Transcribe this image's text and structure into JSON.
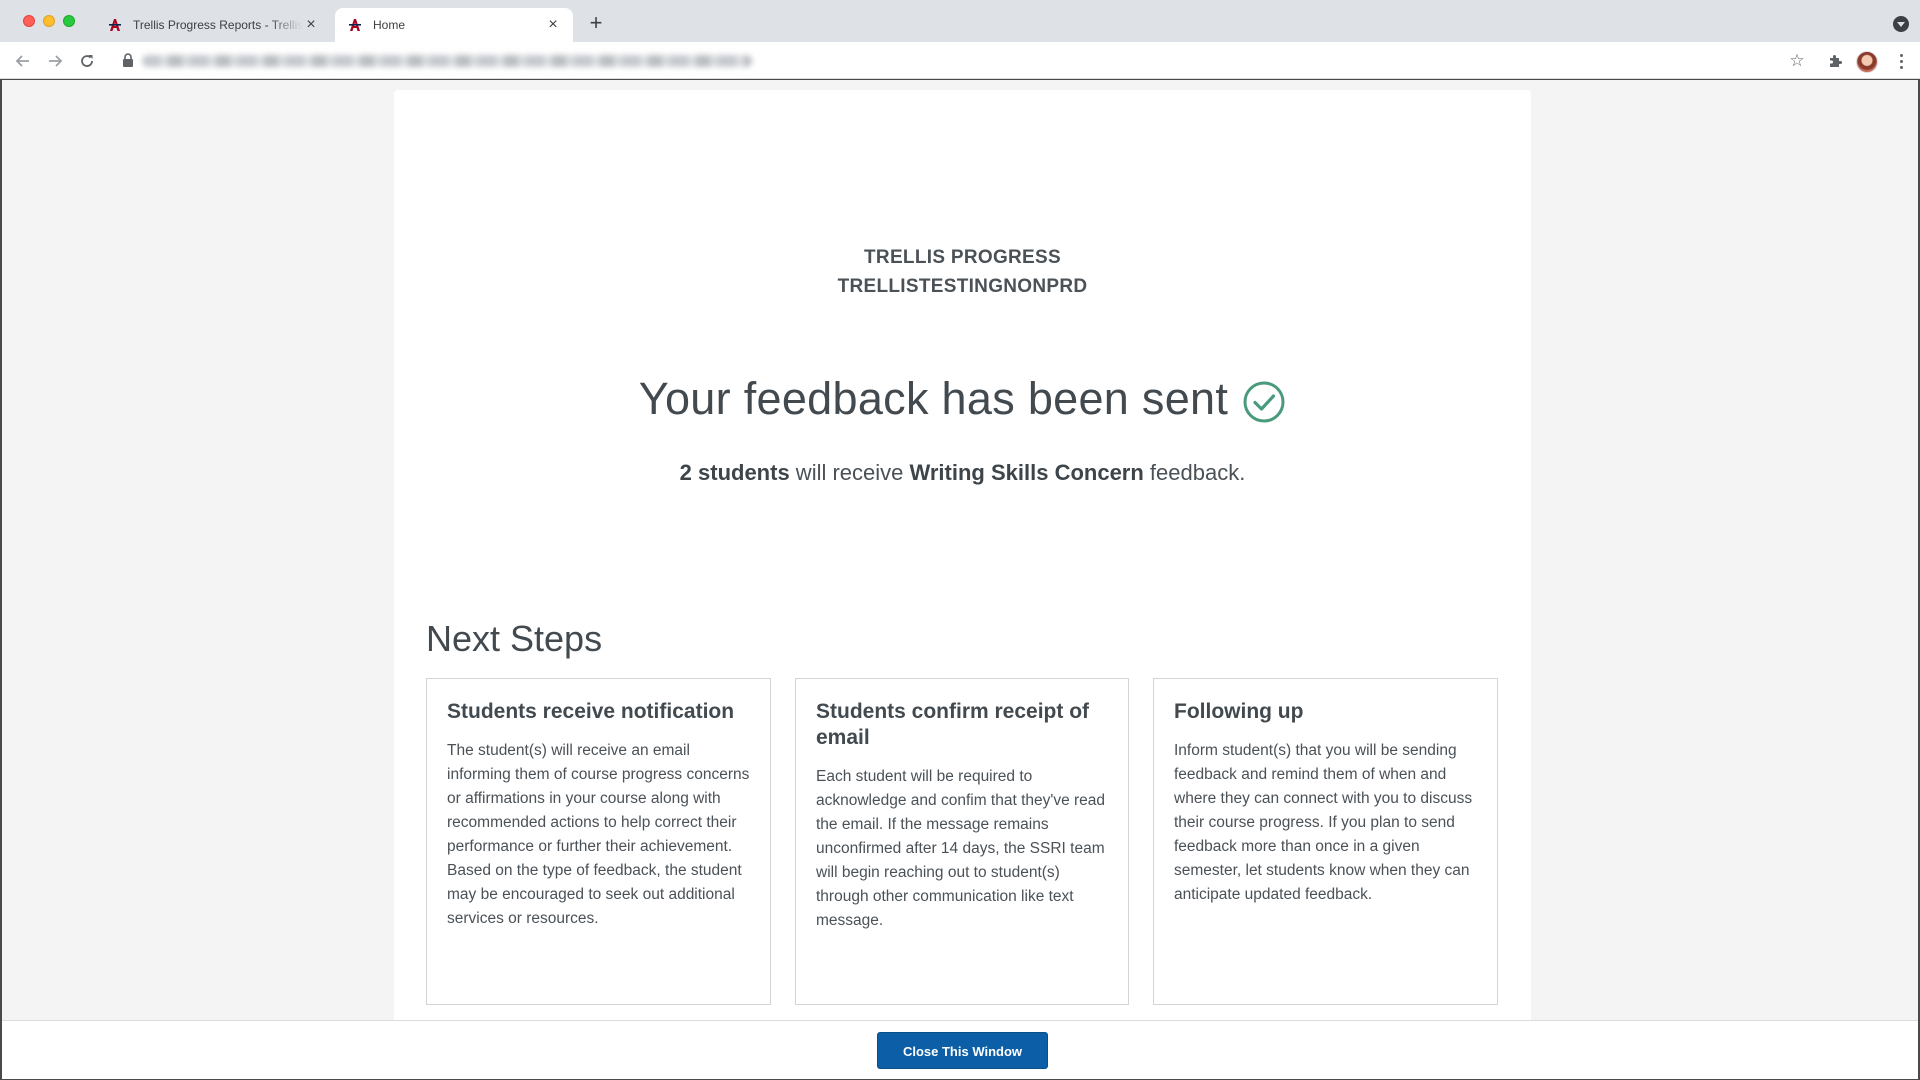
{
  "browser": {
    "tabs": [
      {
        "title": "Trellis Progress Reports - Trellis",
        "active": false
      },
      {
        "title": "Home",
        "active": true
      }
    ],
    "new_tab_label": "+",
    "close_glyph": "×",
    "favicon_letter": "A",
    "icons": [
      "back-icon",
      "forward-icon",
      "reload-icon",
      "lock-icon",
      "star-icon",
      "extensions-icon",
      "avatar",
      "menu-icon",
      "tab-search-icon"
    ],
    "colors": {
      "tab_strip": "#dee1e6",
      "favicon": "#ab0520"
    }
  },
  "page": {
    "org_line_1": "TRELLIS PROGRESS",
    "org_line_2": "TRELLISTESTINGNONPRD",
    "headline": "Your feedback has been sent",
    "summary": {
      "count": "2 students",
      "middle": " will receive ",
      "feedback_type": "Writing Skills Concern",
      "end": " feedback."
    },
    "next_steps_title": "Next Steps",
    "steps": [
      {
        "title": "Students receive notification",
        "body": "The student(s) will receive an email informing them of course progress concerns or affirmations in your course along with recommended actions to help correct their performance or further their achievement. Based on the type of feedback, the student may be encouraged to seek out additional services or resources."
      },
      {
        "title": "Students confirm receipt of email",
        "body": "Each student will be required to acknowledge and confim that they've read the email. If the message remains unconfirmed after 14 days, the SSRI team will begin reaching out to student(s) through other communication like text message."
      },
      {
        "title": "Following up",
        "body": "Inform student(s) that you will be sending feedback and remind them of when and where they can connect with you to discuss their course progress. If you plan to send feedback more than once in a given semester, let students know when they can anticipate updated feedback."
      }
    ],
    "close_button": "Close This Window",
    "colors": {
      "check": "#4a9a7c",
      "button": "#0c5fa6"
    }
  }
}
